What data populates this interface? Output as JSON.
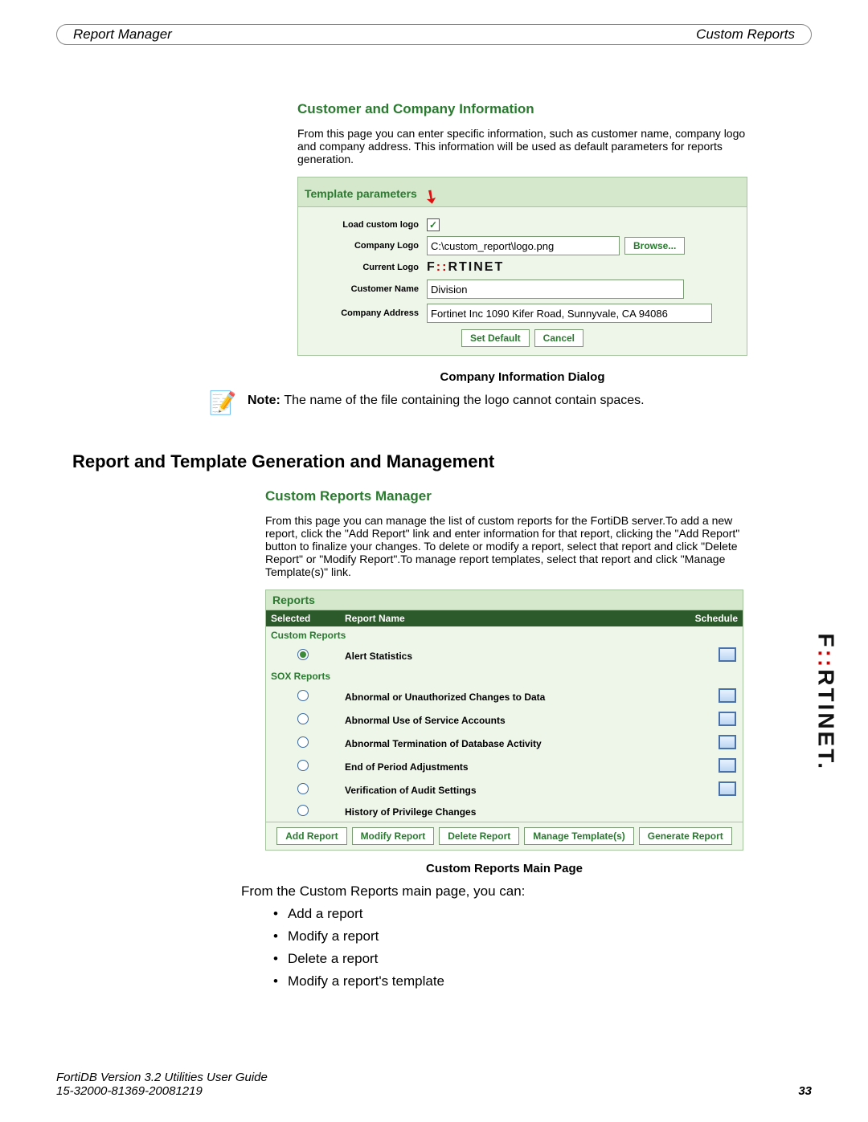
{
  "header": {
    "left": "Report Manager",
    "right": "Custom Reports"
  },
  "panel1": {
    "title": "Customer and Company Information",
    "intro": "From this page you can enter specific information, such as customer name, company logo and company address. This information will be used as default parameters for reports generation.",
    "box_title": "Template parameters",
    "rows": {
      "load_label": "Load custom logo",
      "logo_label": "Company Logo",
      "logo_value": "C:\\custom_report\\logo.png",
      "browse": "Browse...",
      "current_label": "Current Logo",
      "name_label": "Customer Name",
      "name_value": "Division",
      "addr_label": "Company Address",
      "addr_value": "Fortinet Inc 1090 Kifer Road, Sunnyvale, CA 94086",
      "set_default": "Set Default",
      "cancel": "Cancel"
    },
    "caption": "Company Information Dialog"
  },
  "note": {
    "prefix": "Note: ",
    "text": "The name of the file containing the logo cannot contain spaces."
  },
  "h2": "Report and Template Generation and Management",
  "panel2": {
    "title": "Custom Reports Manager",
    "intro": "From this page you can manage the list of custom reports for the FortiDB server.To add a new report, click the \"Add Report\" link and enter information for that report, clicking the \"Add Report\" button to finalize your changes. To delete or modify a report, select that report and click \"Delete Report\" or \"Modify Report\".To manage report templates, select that report and click \"Manage Template(s)\" link.",
    "box_title": "Reports",
    "cols": {
      "sel": "Selected",
      "name": "Report Name",
      "sched": "Schedule"
    },
    "group1": "Custom Reports",
    "group2": "SOX Reports",
    "custom": [
      {
        "name": "Alert Statistics"
      }
    ],
    "sox": [
      {
        "name": "Abnormal or Unauthorized Changes to Data"
      },
      {
        "name": "Abnormal Use of Service Accounts"
      },
      {
        "name": "Abnormal Termination of Database Activity"
      },
      {
        "name": "End of Period Adjustments"
      },
      {
        "name": "Verification of Audit Settings"
      },
      {
        "name": "History of Privilege Changes"
      }
    ],
    "buttons": {
      "add": "Add Report",
      "mod": "Modify Report",
      "del": "Delete Report",
      "tmpl": "Manage Template(s)",
      "gen": "Generate Report"
    },
    "caption": "Custom Reports Main Page"
  },
  "lead": "From the Custom Reports main page, you can:",
  "bullets": [
    "Add a report",
    "Modify a report",
    "Delete a report",
    "Modify a report's template"
  ],
  "footer": {
    "l1": "FortiDB Version 3.2 Utilities  User Guide",
    "l2": "15-32000-81369-20081219",
    "page": "33"
  }
}
